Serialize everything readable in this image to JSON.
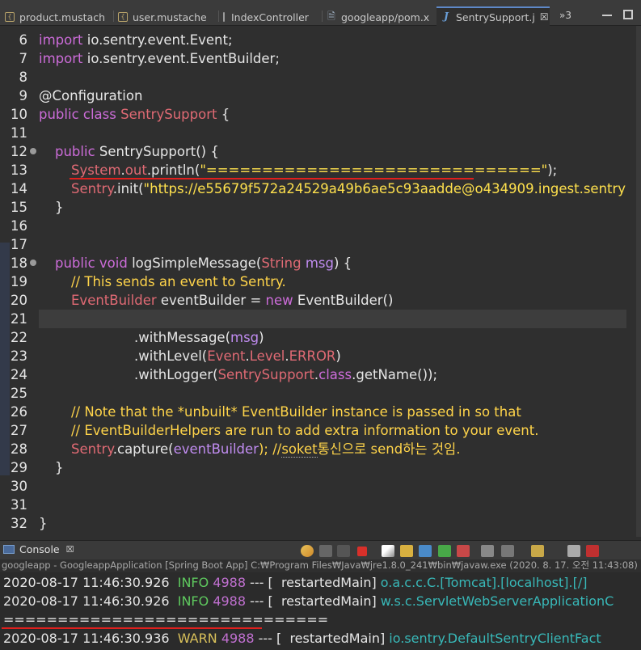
{
  "tabs": [
    {
      "label": "product.mustach",
      "icon": "mustache-file-icon"
    },
    {
      "label": "user.mustache",
      "icon": "mustache-file-icon"
    },
    {
      "label": "IndexController",
      "icon": "java-class-icon"
    },
    {
      "label": "googleapp/pom.x",
      "icon": "xml-file-icon"
    },
    {
      "label": "SentrySupport.j",
      "icon": "java-file-icon",
      "active": true,
      "close": "☒"
    }
  ],
  "tab_overflow": "»3",
  "editor": {
    "line_numbers": [
      "6",
      "7",
      "8",
      "9",
      "10",
      "11",
      "12",
      "13",
      "14",
      "15",
      "16",
      "17",
      "18",
      "19",
      "20",
      "21",
      "22",
      "23",
      "24",
      "25",
      "26",
      "27",
      "28",
      "29",
      "30",
      "31",
      "32"
    ],
    "lines": {
      "l6": [
        "import",
        " io.sentry.event.Event;"
      ],
      "l7": [
        "import",
        " io.sentry.event.EventBuilder;"
      ],
      "l9": "@Configuration",
      "l10": [
        "public",
        " ",
        "class",
        " ",
        "SentrySupport",
        " {"
      ],
      "l12": [
        "public",
        " SentrySupport() {"
      ],
      "l13": [
        "System",
        ".",
        "out",
        ".println(",
        "\"==============================\"",
        ");"
      ],
      "l14": [
        "Sentry",
        ".init(",
        "\"https://e55679f572a24529a49b6ae5c93aadde@o434909.ingest.sentry"
      ],
      "l15": "}",
      "l18": [
        "public",
        " ",
        "void",
        " logSimpleMessage(",
        "String",
        " ",
        "msg",
        ") {"
      ],
      "l19": "// This sends an event to Sentry.",
      "l20": [
        "EventBuilder",
        " eventBuilder = ",
        "new",
        " EventBuilder()"
      ],
      "l22": [
        ".withMessage(",
        "msg",
        ")"
      ],
      "l23": [
        ".withLevel(",
        "Event",
        ".",
        "Level",
        ".",
        "ERROR",
        ")"
      ],
      "l24": [
        ".withLogger(",
        "SentrySupport",
        ".",
        "class",
        ".getName());"
      ],
      "l26": "// Note that the *unbuilt* EventBuilder instance is passed in so that",
      "l27": "// EventBuilderHelpers are run to add extra information to your event.",
      "l28": [
        "Sentry",
        ".capture(",
        "eventBuilder",
        "); //",
        "soket",
        "통신으로 send하는 것임."
      ],
      "l29": "}",
      "l32": "}"
    }
  },
  "console": {
    "tab_label": "Console",
    "close": "☒",
    "launch_info": "googleapp - GoogleappApplication [Spring Boot App] C:₩Program Files₩Java₩jre1.8.0_241₩bin₩javaw.exe (2020. 8. 17. 오전 11:43:08)",
    "lines": [
      {
        "ts": "2020-08-17 11:46:30.926",
        "level": "INFO",
        "pid": "4988",
        "sep": " --- [  restartedMain] ",
        "logger": "o.a.c.c.C.[Tomcat].[localhost].[/]"
      },
      {
        "ts": "2020-08-17 11:46:30.926",
        "level": "INFO",
        "pid": "4988",
        "sep": " --- [  restartedMain] ",
        "logger": "w.s.c.ServletWebServerApplicationC"
      },
      {
        "text": "=============================="
      },
      {
        "ts": "2020-08-17 11:46:30.936",
        "level": "WARN",
        "pid": "4988",
        "sep": " --- [  restartedMain] ",
        "logger": "io.sentry.DefaultSentryClientFact"
      }
    ]
  },
  "colors": {
    "keyword": "#cc6cd9",
    "type": "#e06a74",
    "string": "#ffe14d",
    "comment": "#ffd44a",
    "info": "#5ec85e",
    "warn": "#d8c05a",
    "logger": "#38b8b8",
    "annotation_underline": "#e0201e"
  }
}
